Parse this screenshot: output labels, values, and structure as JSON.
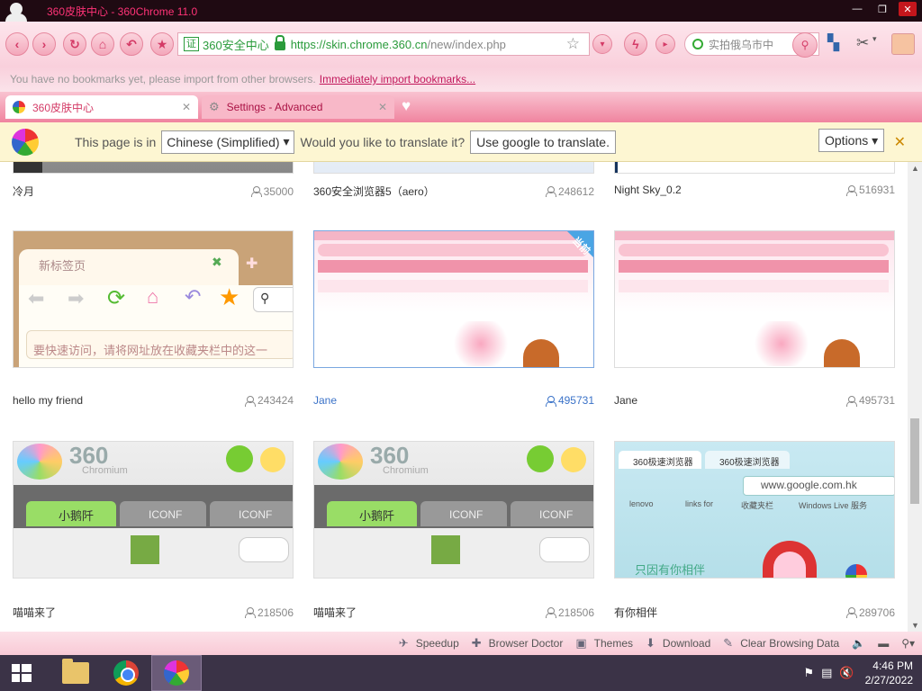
{
  "window": {
    "title": "360皮肤中心 - 360Chrome 11.0"
  },
  "address": {
    "cert": "证",
    "secure": "360安全中心",
    "url_host": "https://skin.chrome.360.cn",
    "url_path": "/new/index.php"
  },
  "search": {
    "placeholder": "实拍俄乌市中"
  },
  "bookmarks": {
    "message": "You have no bookmarks yet, please import from other browsers.",
    "link": "Immediately import bookmarks..."
  },
  "tabs": [
    {
      "label": "360皮肤中心",
      "active": true
    },
    {
      "label": "Settings - Advanced",
      "active": false
    }
  ],
  "translate": {
    "prefix": "This page is in",
    "language": "Chinese (Simplified)",
    "question": "Would you like to translate it?",
    "action": "Use google to translate.",
    "options": "Options"
  },
  "skins": [
    {
      "name": "冷月",
      "count": "35000"
    },
    {
      "name": "360安全浏览器5（aero）",
      "count": "248612"
    },
    {
      "name": "Night Sky_0.2",
      "count": "516931"
    },
    {
      "name": "hello my friend",
      "count": "243424"
    },
    {
      "name": "Jane",
      "count": "495731",
      "badge": "当前"
    },
    {
      "name": "Jane",
      "count": "495731"
    },
    {
      "name": "喵喵来了",
      "count": "218506"
    },
    {
      "name": "喵喵来了",
      "count": "218506"
    },
    {
      "name": "有你相伴",
      "count": "289706"
    }
  ],
  "thumbs": {
    "t1_tab": "新标签页",
    "t1_hint": "要快速访问，请将网址放在收藏夹栏中的这一",
    "t2_tab1": "小鹅阡",
    "t2_tab2": "ICONF",
    "t2_tab3": "ICONF",
    "t3_tab1": "360极速浏览器",
    "t3_tab2": "360极速浏览器",
    "t3_url": "www.google.com.hk",
    "t3_bm1": "lenovo",
    "t3_bm2": "links for",
    "t3_bm3": "收藏夹栏",
    "t3_bm4": "Windows Live 服务",
    "t3_text": "只因有你相伴",
    "logo": "360",
    "logo_sub": "Chromium"
  },
  "status": {
    "speedup": "Speedup",
    "doctor": "Browser Doctor",
    "themes": "Themes",
    "download": "Download",
    "clear": "Clear Browsing Data"
  },
  "clock": {
    "time": "4:46 PM",
    "date": "2/27/2022"
  },
  "colors": {
    "accent": "#d43a66",
    "selected": "#3a72c8",
    "titlebar": "#1f0a12"
  }
}
